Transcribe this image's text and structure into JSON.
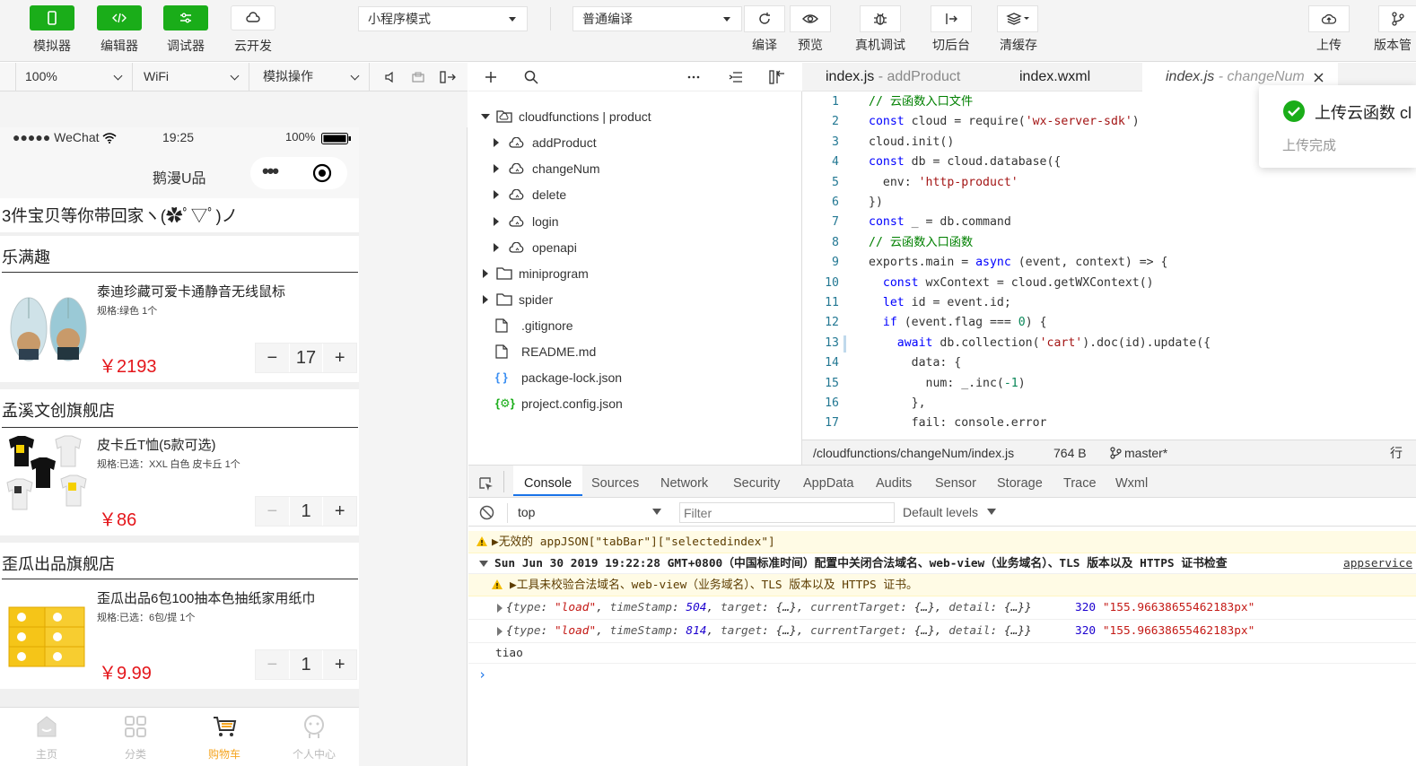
{
  "toolbar": {
    "simulator": "模拟器",
    "editor": "编辑器",
    "debugger": "调试器",
    "cloud": "云开发",
    "mode": "小程序模式",
    "compile_mode": "普通编译",
    "compile": "编译",
    "preview": "预览",
    "real_debug": "真机调试",
    "background": "切后台",
    "clear_cache": "清缓存",
    "upload": "上传",
    "version": "版本管"
  },
  "simbar": {
    "zoom": "100%",
    "network": "WiFi",
    "sim_ops": "模拟操作"
  },
  "phone": {
    "carrier": "●●●●● WeChat",
    "time": "19:25",
    "battery": "100%",
    "nav_title": "鹅漫U品",
    "nav_menu": "•••",
    "banner": "3件宝贝等你带回家ヽ(✿ﾟ▽ﾟ)ノ",
    "shops": [
      {
        "name": "乐满趣",
        "item": "泰迪珍藏可爱卡通静音无线鼠标",
        "spec": "规格:绿色 1个",
        "price": "￥2193",
        "qty": "17"
      },
      {
        "name": "孟溪文创旗舰店",
        "item": "皮卡丘T恤(5款可选)",
        "spec": "规格:已选：XXL 白色 皮卡丘 1个",
        "price": "￥86",
        "qty": "1"
      },
      {
        "name": "歪瓜出品旗舰店",
        "item": "歪瓜出品6包100抽本色抽纸家用纸巾",
        "spec": "规格:已选：6包/提 1个",
        "price": "￥9.99",
        "qty": "1"
      }
    ],
    "stepper_minus": "−",
    "stepper_plus": "+",
    "tabs": [
      {
        "label": "主页",
        "icon": "home-icon"
      },
      {
        "label": "分类",
        "icon": "category-icon"
      },
      {
        "label": "购物车",
        "icon": "cart-icon",
        "active": true
      },
      {
        "label": "个人中心",
        "icon": "profile-icon"
      }
    ],
    "active_color": "#f5a623"
  },
  "explorer": {
    "root": "cloudfunctions | product",
    "items": [
      {
        "label": "addProduct",
        "type": "cloud-folder"
      },
      {
        "label": "changeNum",
        "type": "cloud-folder"
      },
      {
        "label": "delete",
        "type": "cloud-folder"
      },
      {
        "label": "login",
        "type": "cloud-folder"
      },
      {
        "label": "openapi",
        "type": "cloud-folder"
      },
      {
        "label": "miniprogram",
        "type": "folder"
      },
      {
        "label": "spider",
        "type": "folder"
      },
      {
        "label": ".gitignore",
        "type": "file"
      },
      {
        "label": "README.md",
        "type": "file"
      },
      {
        "label": "package-lock.json",
        "type": "json"
      },
      {
        "label": "project.config.json",
        "type": "config"
      }
    ]
  },
  "editor": {
    "tabs": [
      {
        "file": "index.js",
        "path": " - addProduct"
      },
      {
        "file": "index.wxml",
        "path": ""
      },
      {
        "file": "index.js",
        "path": " - changeNum",
        "active": true
      }
    ],
    "lines": [
      "1",
      "2",
      "3",
      "4",
      "5",
      "6",
      "7",
      "8",
      "9",
      "10",
      "11",
      "12",
      "13",
      "14",
      "15",
      "16",
      "17"
    ],
    "status_path": "/cloudfunctions/changeNum/index.js",
    "status_size": "764 B",
    "status_branch": "master*",
    "status_line": "行"
  },
  "toast": {
    "title": "上传云函数 cl",
    "sub": "上传完成"
  },
  "devtools": {
    "tabs": [
      "Console",
      "Sources",
      "Network",
      "Security",
      "AppData",
      "Audits",
      "Sensor",
      "Storage",
      "Trace",
      "Wxml"
    ],
    "context": "top",
    "filter_placeholder": "Filter",
    "levels": "Default levels",
    "log1": "▶无效的 appJSON[\"tabBar\"][\"selectedindex\"]",
    "log2": "Sun Jun 30 2019 19:22:28 GMT+0800（中国标准时间）配置中关闭合法域名、web-view（业务域名）、TLS 版本以及 HTTPS 证书检查",
    "log2_link": "appservice",
    "log3": "▶工具未校验合法域名、web-view（业务域名）、TLS 版本以及 HTTPS 证书。",
    "log6": "tiao",
    "prompt": "›"
  }
}
